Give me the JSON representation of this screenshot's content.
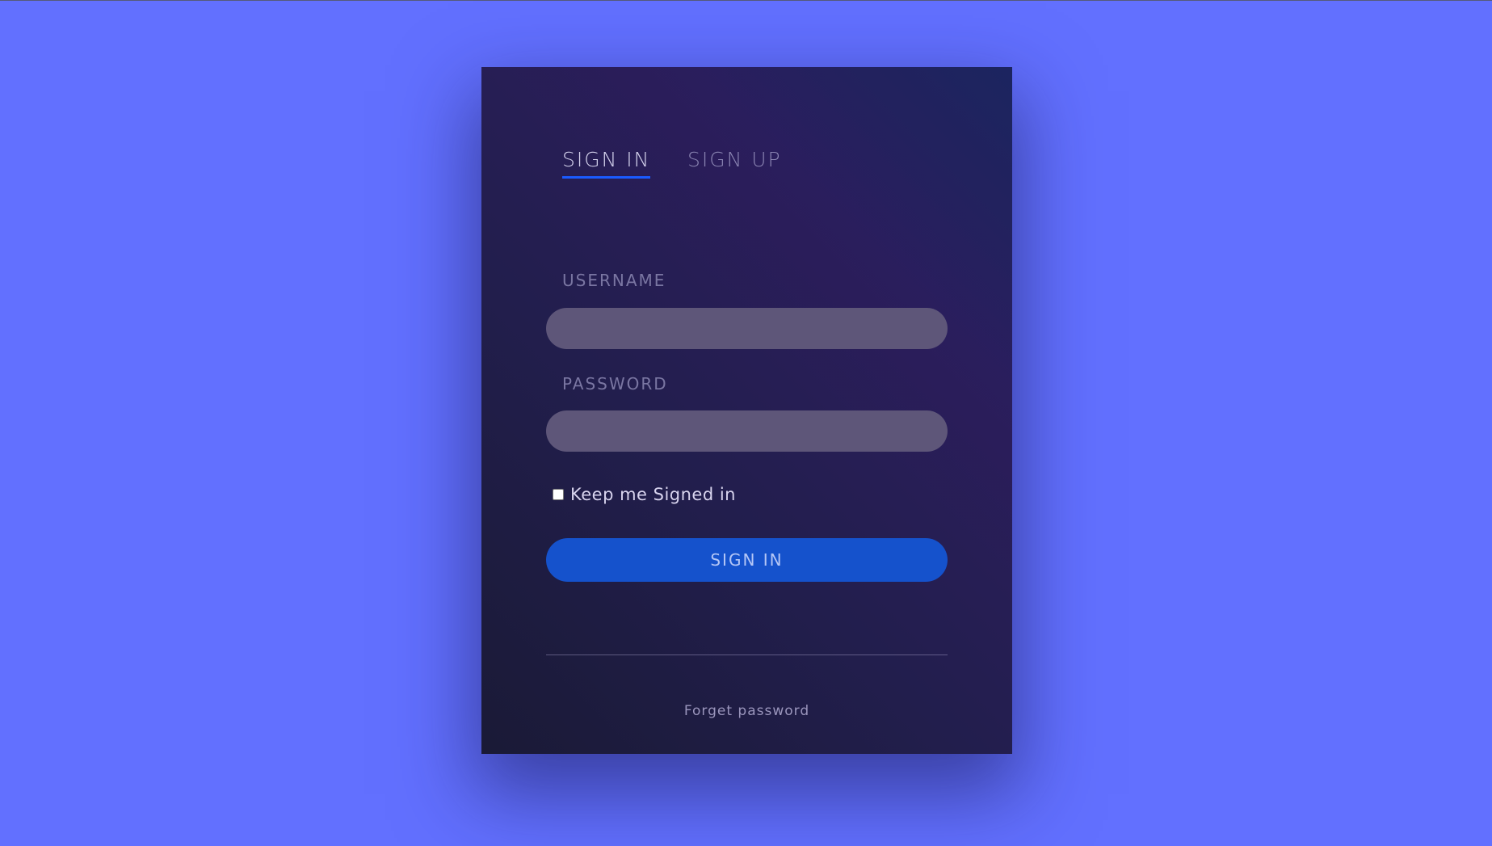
{
  "tabs": {
    "sign_in": "SIGN IN",
    "sign_up": "SIGN UP"
  },
  "form": {
    "username_label": "USERNAME",
    "username_value": "",
    "password_label": "PASSWORD",
    "password_value": "",
    "remember_label": "Keep me Signed in",
    "remember_checked": false,
    "submit_label": "SIGN IN"
  },
  "footer": {
    "forgot_label": "Forget password"
  },
  "colors": {
    "page_background": "#6270ff",
    "accent": "#1552cc",
    "active_tab_underline": "#1a5bff"
  }
}
